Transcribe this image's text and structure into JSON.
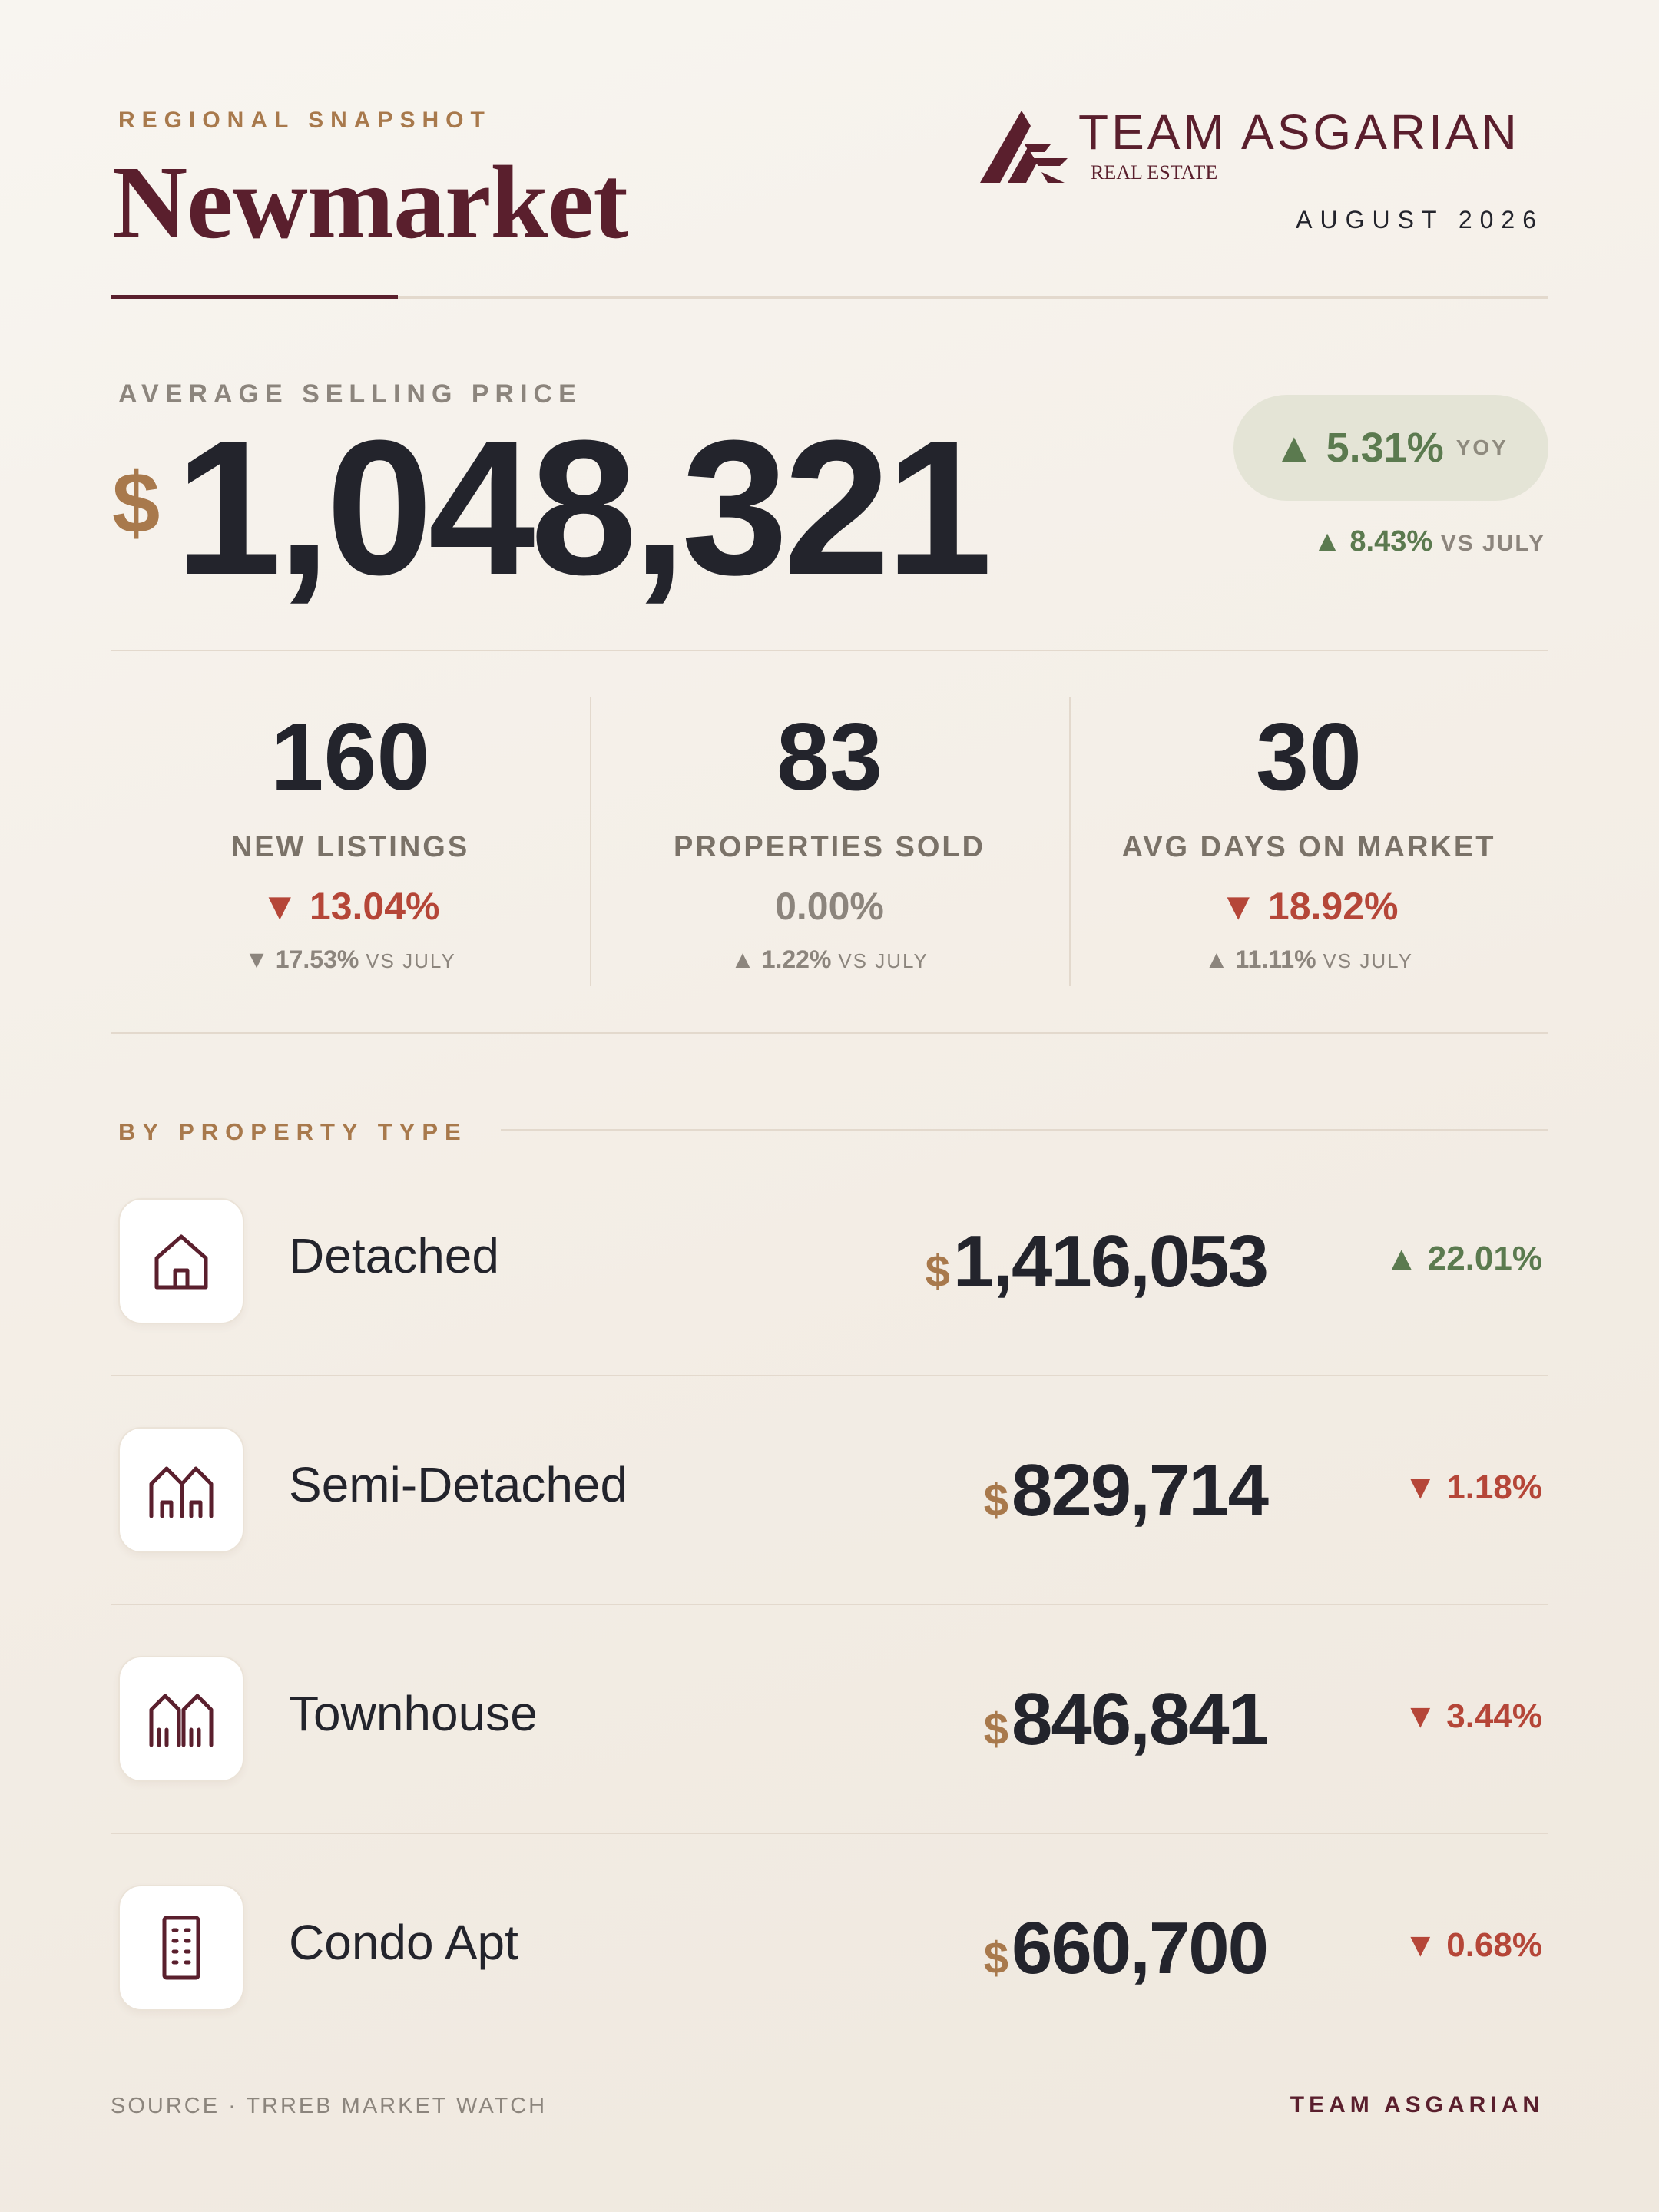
{
  "header": {
    "kicker": "REGIONAL SNAPSHOT",
    "city": "Newmarket",
    "brand_name": "TEAM ASGARIAN",
    "brand_sub": "REAL ESTATE",
    "date": "AUGUST 2026"
  },
  "hero": {
    "label": "AVERAGE SELLING PRICE",
    "currency": "$",
    "value": "1,048,321",
    "yoy_change": "▲ 5.31%",
    "yoy_tag": "YOY",
    "mom_change": "▲ 8.43%",
    "mom_tag": "VS JULY"
  },
  "stats": [
    {
      "value": "160",
      "label": "NEW LISTINGS",
      "change": "▼ 13.04%",
      "sub_change": "▼ 17.53%",
      "sub_tag": "VS JULY"
    },
    {
      "value": "83",
      "label": "PROPERTIES SOLD",
      "change": "0.00%",
      "sub_change": "▲ 1.22%",
      "sub_tag": "VS JULY"
    },
    {
      "value": "30",
      "label": "AVG DAYS ON MARKET",
      "change": "▼ 18.92%",
      "sub_change": "▲ 11.11%",
      "sub_tag": "VS JULY"
    }
  ],
  "by_type": {
    "label": "BY PROPERTY TYPE",
    "rows": [
      {
        "icon": "detached-house-icon",
        "name": "Detached",
        "currency": "$",
        "price": "1,416,053",
        "change": "▲ 22.01%"
      },
      {
        "icon": "semi-detached-icon",
        "name": "Semi-Detached",
        "currency": "$",
        "price": "829,714",
        "change": "▼ 1.18%"
      },
      {
        "icon": "townhouse-icon",
        "name": "Townhouse",
        "currency": "$",
        "price": "846,841",
        "change": "▼ 3.44%"
      },
      {
        "icon": "condo-building-icon",
        "name": "Condo Apt",
        "currency": "$",
        "price": "660,700",
        "change": "▼ 0.68%"
      }
    ]
  },
  "footer": {
    "source": "SOURCE · TRREB MARKET WATCH",
    "brand": "TEAM ASGARIAN"
  },
  "colors": {
    "maroon": "#5a1f2d",
    "gold": "#a8794c",
    "green": "#5b7a4f",
    "red": "#b54638",
    "ink": "#23242c"
  }
}
